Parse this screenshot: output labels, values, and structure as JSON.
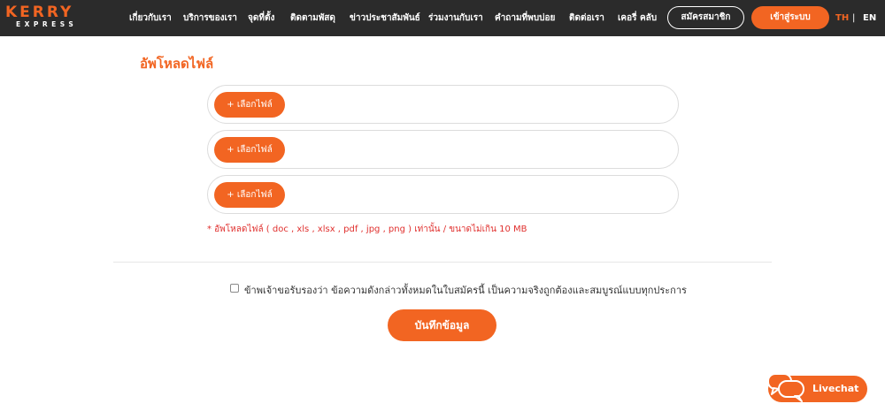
{
  "brand": {
    "word": "KERRY",
    "sub": "EXPRESS",
    "accent": "#f26522",
    "topbar_bg": "#2b2b2b"
  },
  "nav": {
    "items": [
      {
        "label": "เกี่ยวกับเรา"
      },
      {
        "label": "บริการของเรา"
      },
      {
        "label": "จุดที่ตั้ง"
      },
      {
        "label": "ติดตามพัสดุ"
      },
      {
        "label": "ข่าวประชาสัมพันธ์"
      },
      {
        "label": "ร่วมงานกับเรา"
      },
      {
        "label": "คำถามที่พบบ่อย"
      },
      {
        "label": "ติดต่อเรา"
      },
      {
        "label": "เคอรี่ คลับ"
      }
    ],
    "register_label": "สมัครสมาชิก",
    "login_label": "เข้าสู่ระบบ",
    "lang_th": "TH",
    "lang_sep": "|",
    "lang_en": "EN",
    "active_lang_color": "#f26522"
  },
  "main": {
    "title": "อัพโหลดไฟล์",
    "upload_rows": [
      {
        "button_label": "+ เลือกไฟล์"
      },
      {
        "button_label": "+ เลือกไฟล์"
      },
      {
        "button_label": "+ เลือกไฟล์"
      }
    ],
    "note": "* อัพโหลดไฟล์ ( doc , xls , xlsx , pdf , jpg , png ) เท่านั้น / ขนาดไม่เกิน 10 MB",
    "agree_text": "ข้าพเจ้าขอรับรองว่า ข้อความดังกล่าวทั้งหมดในใบสมัครนี้ เป็นความจริงถูกต้องและสมบูรณ์แบบทุกประการ",
    "agree_checked": false,
    "save_label": "บันทึกข้อมูล"
  },
  "livechat": {
    "label": "Livechat",
    "icon": "chat-bubbles-icon"
  }
}
